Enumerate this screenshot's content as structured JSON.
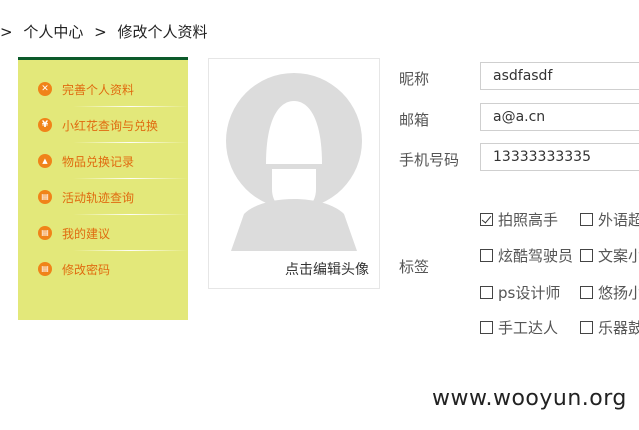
{
  "breadcrumb": {
    "lead": ">",
    "items": [
      "个人中心",
      "修改个人资料"
    ],
    "separator": ">"
  },
  "sidebar": {
    "items": [
      {
        "label": "完善个人资料",
        "icon": "tools-icon",
        "glyph": "✕"
      },
      {
        "label": "小红花查询与兑换",
        "icon": "yuan-icon",
        "glyph": "¥"
      },
      {
        "label": "物品兑换记录",
        "icon": "gift-icon",
        "glyph": "▲"
      },
      {
        "label": "活动轨迹查询",
        "icon": "document-icon",
        "glyph": "▤"
      },
      {
        "label": "我的建议",
        "icon": "note-icon",
        "glyph": "▤"
      },
      {
        "label": "修改密码",
        "icon": "lock-icon",
        "glyph": "▤"
      }
    ]
  },
  "avatar": {
    "edit_label": "点击编辑头像"
  },
  "form": {
    "nickname": {
      "label": "昵称",
      "value": "asdfasdf"
    },
    "email": {
      "label": "邮箱",
      "value": "a@a.cn"
    },
    "phone": {
      "label": "手机号码",
      "value": "13333333335"
    },
    "tags": {
      "label": "标签",
      "options": [
        {
          "label": "拍照高手",
          "checked": true
        },
        {
          "label": "外语超",
          "checked": false
        },
        {
          "label": "炫酷驾驶员",
          "checked": false
        },
        {
          "label": "文案小",
          "checked": false
        },
        {
          "label": "ps设计师",
          "checked": false
        },
        {
          "label": "悠扬小",
          "checked": false
        },
        {
          "label": "手工达人",
          "checked": false
        },
        {
          "label": "乐器鼓",
          "checked": false
        }
      ]
    }
  },
  "watermark": "www.wooyun.org",
  "colors": {
    "sidebar_bg": "#e3e87a",
    "sidebar_border": "#0c5a2a",
    "accent_orange": "#f08319",
    "menu_text": "#e06b10"
  }
}
